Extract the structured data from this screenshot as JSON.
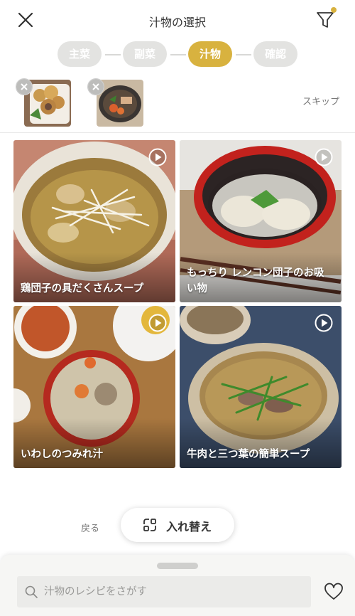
{
  "header": {
    "title": "汁物の選択"
  },
  "steps": [
    {
      "label": "主菜",
      "active": false
    },
    {
      "label": "副菜",
      "active": false
    },
    {
      "label": "汁物",
      "active": true
    },
    {
      "label": "確認",
      "active": false
    }
  ],
  "selected": {
    "skip_label": "スキップ"
  },
  "recipes": [
    {
      "name": "鶏団子の具だくさんスープ"
    },
    {
      "name": "もっちり レンコン団子のお吸い物"
    },
    {
      "name": "いわしのつみれ汁"
    },
    {
      "name": "牛肉と三つ葉の簡単スープ"
    }
  ],
  "actions": {
    "back_label": "戻る",
    "swap_label": "入れ替え"
  },
  "search": {
    "placeholder": "汁物のレシピをさがす"
  },
  "colors": {
    "accent": "#d8b23f",
    "step_inactive": "#e3e3e1"
  }
}
